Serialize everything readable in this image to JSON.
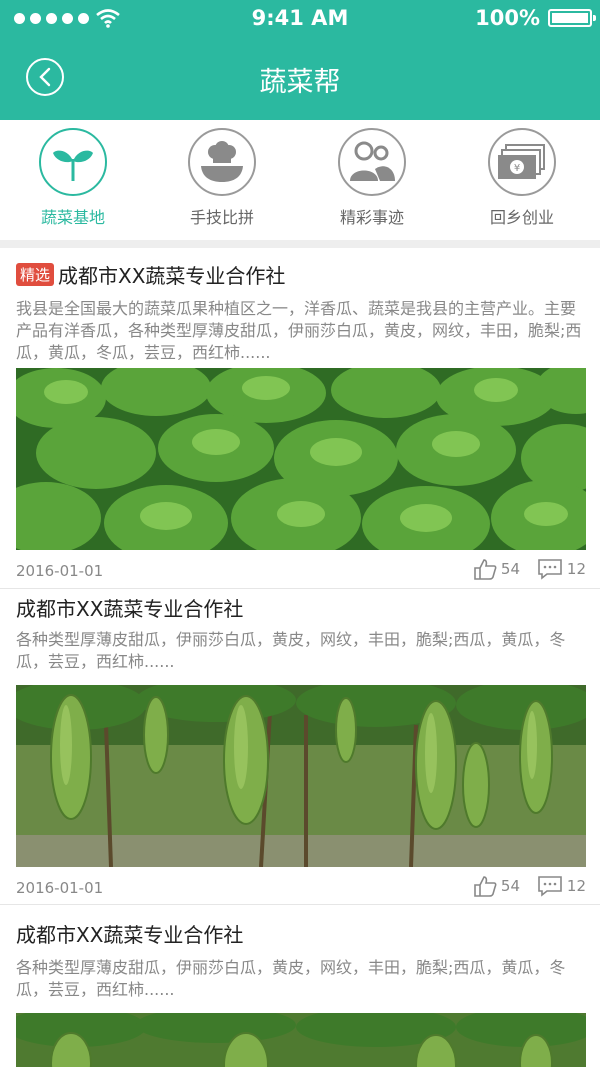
{
  "status_bar": {
    "time": "9:41 AM",
    "battery": "100%"
  },
  "header": {
    "title": "蔬菜帮",
    "back_icon": "back-arrow-icon"
  },
  "colors": {
    "brand": "#2bb9a0",
    "tag": "#e04d3e"
  },
  "nav": {
    "items": [
      {
        "label": "蔬菜基地",
        "icon": "sprout-icon",
        "active": true
      },
      {
        "label": "手技比拼",
        "icon": "chef-hat-icon",
        "active": false
      },
      {
        "label": "精彩事迹",
        "icon": "people-icon",
        "active": false
      },
      {
        "label": "回乡创业",
        "icon": "money-icon",
        "active": false
      }
    ]
  },
  "cards": [
    {
      "tag": "精选",
      "title": "成都市XX蔬菜专业合作社",
      "description": "我县是全国最大的蔬菜瓜果种植区之一，洋香瓜、蔬菜是我县的主营产业。主要产品有洋香瓜，各种类型厚薄皮甜瓜，伊丽莎白瓜，黄皮，网纹，丰田，脆梨;西瓜，黄瓜，冬瓜，芸豆，西红柿......",
      "image": "lettuce-field",
      "date": "2016-01-01",
      "likes": "54",
      "comments": "12"
    },
    {
      "title": "成都市XX蔬菜专业合作社",
      "description": "各种类型厚薄皮甜瓜，伊丽莎白瓜，黄皮，网纹，丰田，脆梨;西瓜，黄瓜，冬瓜，芸豆，西红柿......",
      "image": "bitter-melon-vines",
      "date": "2016-01-01",
      "likes": "54",
      "comments": "12"
    },
    {
      "title": "成都市XX蔬菜专业合作社",
      "description": "各种类型厚薄皮甜瓜，伊丽莎白瓜，黄皮，网纹，丰田，脆梨;西瓜，黄瓜，冬瓜，芸豆，西红柿......",
      "image": "bitter-melon-vines"
    }
  ]
}
